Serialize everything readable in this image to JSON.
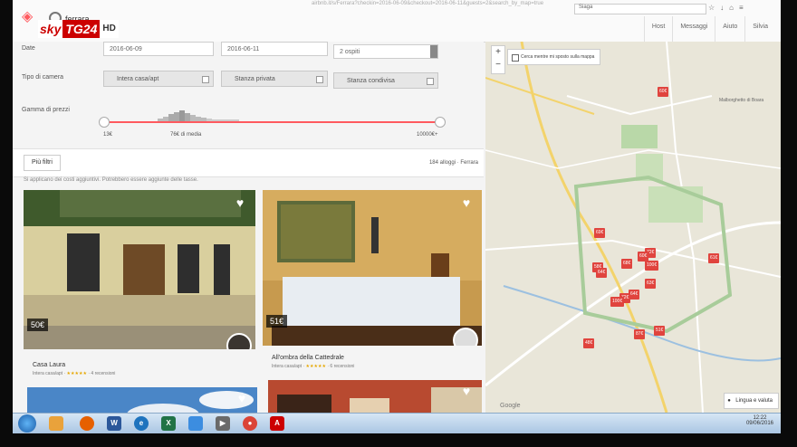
{
  "overlay": {
    "brand_sky": "sky",
    "brand_tg": "TG24",
    "brand_hd": "HD"
  },
  "browser": {
    "url_fragment": "airbnb.it/s/Ferrara?checkin=2016-06-09&checkout=2016-06-11&guests=2&search_by_map=true",
    "urlbar_right": "Siaga"
  },
  "header": {
    "search_value": "ferrara",
    "buttons": [
      {
        "label": "Host"
      },
      {
        "label": "Messaggi"
      },
      {
        "label": "Aiuto"
      },
      {
        "label": "Silvia"
      }
    ]
  },
  "filters": {
    "date_label": "Date",
    "checkin": "2016-06-09",
    "checkout": "2016-06-11",
    "guests": "2 ospiti",
    "room_type_label": "Tipo di camera",
    "room_types": [
      {
        "label": "Intera casa/apt",
        "checked": true
      },
      {
        "label": "Stanza privata",
        "checked": false
      },
      {
        "label": "Stanza condivisa",
        "checked": false
      }
    ],
    "price_label": "Gamma di prezzi",
    "price_min": "13€",
    "price_avg": "76€ di media",
    "price_max": "10000€+",
    "more_filters": "Più filtri",
    "results_count": "184 alloggi · Ferrara",
    "notice": "Si applicano dei costi aggiuntivi. Potrebbero essere aggiunte delle tasse."
  },
  "listings": [
    {
      "title": "Casa Laura",
      "subtitle": "Intera casa/apt",
      "stars": "★★★★★",
      "reviews": "4 recensioni",
      "price": "50€"
    },
    {
      "title": "All'ombra della Cattedrale",
      "subtitle": "Intera casa/apt",
      "stars": "★★★★★",
      "reviews": "6 recensioni",
      "price": "51€"
    },
    {
      "title": "",
      "subtitle": "",
      "stars": "",
      "reviews": "",
      "price": ""
    },
    {
      "title": "",
      "subtitle": "",
      "stars": "",
      "reviews": "",
      "price": ""
    }
  ],
  "map": {
    "zoom_in": "+",
    "zoom_out": "−",
    "search_checkbox": "Cerca mentre mi sposto sulla mappa",
    "district_label": "Malborghetto di Boara",
    "pins": [
      "60€",
      "69€",
      "68€",
      "72€",
      "61€",
      "58€",
      "100€",
      "64€",
      "63€",
      "64€",
      "72€",
      "100€",
      "87€",
      "51€",
      "48€",
      "60€"
    ],
    "language_button": "Lingua e valuta",
    "google": "Google"
  },
  "taskbar": {
    "icons": [
      "W",
      "e",
      "X",
      "▶",
      "●",
      "A"
    ],
    "time": "12:22",
    "date": "09/06/2016"
  }
}
